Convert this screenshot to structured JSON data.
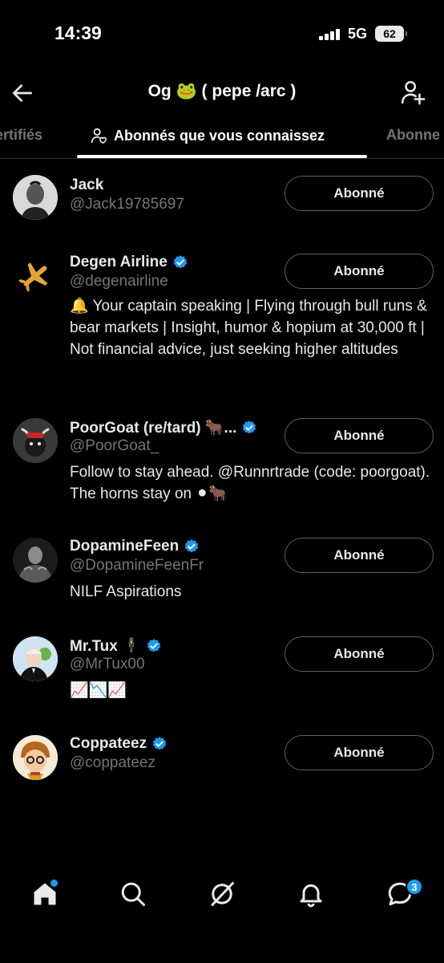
{
  "status_bar": {
    "time": "14:39",
    "network": "5G",
    "battery": "62"
  },
  "header": {
    "title": "Og 🐸 ( pepe /arc )"
  },
  "tabs": [
    {
      "label": "ertifiés"
    },
    {
      "label": "Abonnés que vous connaissez",
      "active": true
    },
    {
      "label": "Abonne"
    }
  ],
  "users": [
    {
      "name": "Jack",
      "handle": "@Jack19785697",
      "verified": false,
      "bio": "",
      "button": "Abonné"
    },
    {
      "name": "Degen Airline",
      "handle": "@degenairline",
      "verified": true,
      "bio": "🔔 Your captain speaking | Flying through bull runs & bear markets | Insight, humor & hopium at 30,000 ft | Not financial advice, just seeking higher altitudes",
      "button": "Abonné"
    },
    {
      "name": "PoorGoat (re/tard) 🐂...",
      "handle": "@PoorGoat_",
      "verified": true,
      "bio": "Follow to stay ahead. @Runnrtrade (code: poorgoat). The horns stay on ⚫🐂",
      "button": "Abonné"
    },
    {
      "name": "DopamineFeen",
      "handle": "@DopamineFeenFr",
      "verified": true,
      "bio": "NILF Aspirations",
      "button": "Abonné"
    },
    {
      "name": "Mr.Tux 🕴",
      "handle": "@MrTux00",
      "verified": true,
      "bio": "📈📉📈",
      "button": "Abonné"
    },
    {
      "name": "Coppateez",
      "handle": "@coppateez",
      "verified": true,
      "bio": "",
      "button": "Abonné"
    }
  ],
  "bottom_nav": {
    "messages_badge": "3"
  },
  "colors": {
    "background": "#000000",
    "accent": "#1d9bf0",
    "muted": "#71767b",
    "border": "#536471"
  }
}
